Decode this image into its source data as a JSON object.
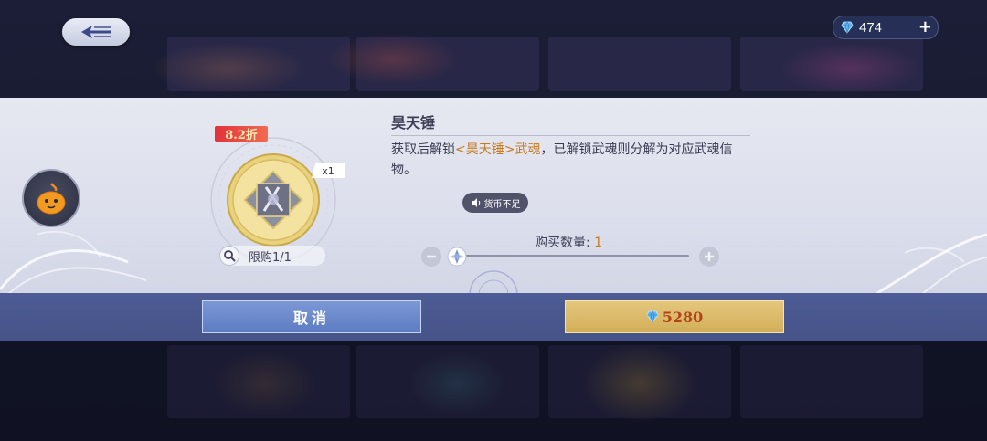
{
  "topbar": {
    "currency_amount": "474",
    "plus_symbol": "+"
  },
  "item": {
    "title": "昊天锤",
    "discount": "8.2折",
    "quantity_badge": "x1",
    "purchase_limit": "限购1/1",
    "desc_prefix": "获取后解锁",
    "desc_highlight": "<昊天锤>武魂",
    "desc_suffix": "，已解锁武魂则分解为对应武魂信物。"
  },
  "toast": {
    "text": "货币不足"
  },
  "purchase": {
    "quantity_label": "购买数量:",
    "quantity_value": "1",
    "slider_fraction": 0
  },
  "buttons": {
    "cancel_label": "取消",
    "buy_price": "5280"
  },
  "colors": {
    "highlight": "#c87a1e",
    "cancel_button": "#6b88cc",
    "buy_button": "#dcbb6a",
    "price_text": "#b24518"
  }
}
